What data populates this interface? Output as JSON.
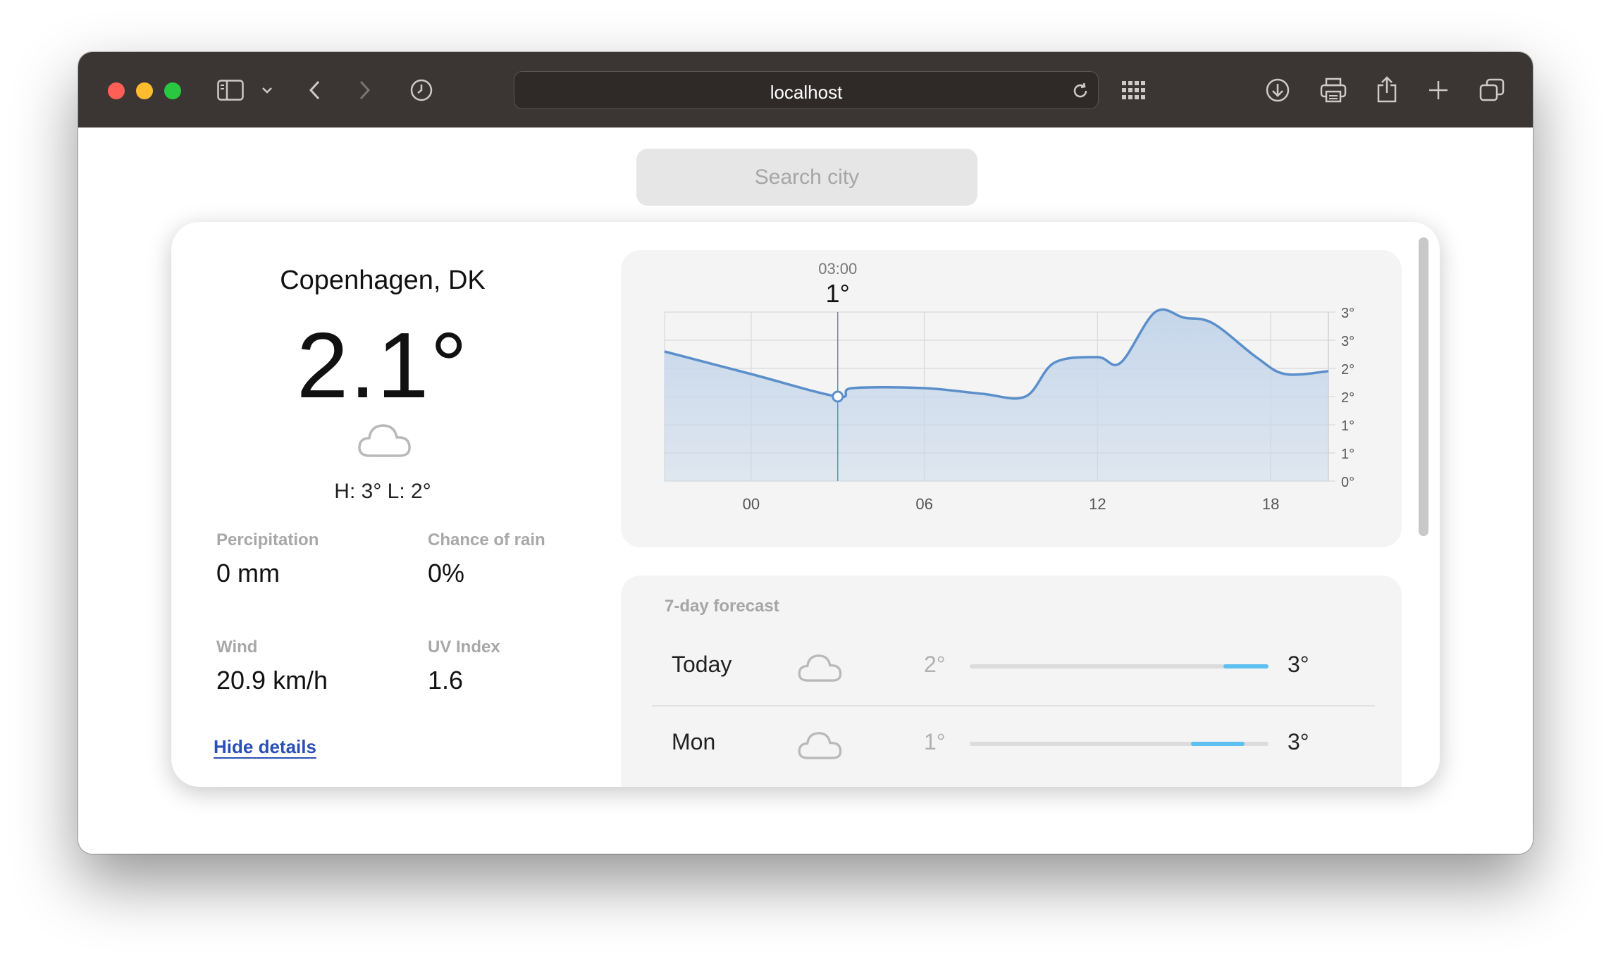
{
  "browser": {
    "url": "localhost",
    "traffic_lights": [
      "#ff5f57",
      "#febc2e",
      "#28c840"
    ]
  },
  "search": {
    "placeholder": "Search city"
  },
  "current": {
    "city": "Copenhagen, DK",
    "temperature": "2.1°",
    "condition_icon": "cloud-icon",
    "high_low": "H: 3° L: 2°",
    "stats": [
      {
        "label": "Percipitation",
        "value": "0 mm"
      },
      {
        "label": "Chance of rain",
        "value": "0%"
      },
      {
        "label": "Wind",
        "value": "20.9 km/h"
      },
      {
        "label": "UV Index",
        "value": "1.6"
      }
    ],
    "hide_details": "Hide details"
  },
  "chart_data": {
    "type": "area",
    "tooltip": {
      "time": "03:00",
      "value": "1°"
    },
    "x_tick_labels": [
      "00",
      "06",
      "12",
      "18"
    ],
    "y_tick_labels": [
      "0°",
      "1°",
      "1°",
      "2°",
      "2°",
      "3°",
      "3°"
    ],
    "x_hours": [
      -3,
      0,
      3,
      3.5,
      6,
      8,
      9.5,
      10.5,
      12,
      12.8,
      14,
      15,
      16,
      17.5,
      18.5,
      20
    ],
    "temperatures": [
      2.3,
      1.9,
      1.5,
      1.65,
      1.65,
      1.55,
      1.5,
      2.1,
      2.2,
      2.1,
      3.0,
      2.9,
      2.8,
      2.2,
      1.9,
      1.95
    ],
    "ylim": [
      0,
      3
    ],
    "xlim": [
      -3,
      20
    ],
    "selected_hour": 3,
    "grid": true,
    "line_color": "#5b8fcb",
    "fill_color": "#c5d6ea"
  },
  "forecast": {
    "title": "7-day forecast",
    "days": [
      {
        "day": "Today",
        "icon": "cloud-icon",
        "low": "2°",
        "high": "3°",
        "range_start": 0.85,
        "range_end": 1.0
      },
      {
        "day": "Mon",
        "icon": "cloud-icon",
        "low": "1°",
        "high": "3°",
        "range_start": 0.74,
        "range_end": 0.92
      }
    ]
  }
}
